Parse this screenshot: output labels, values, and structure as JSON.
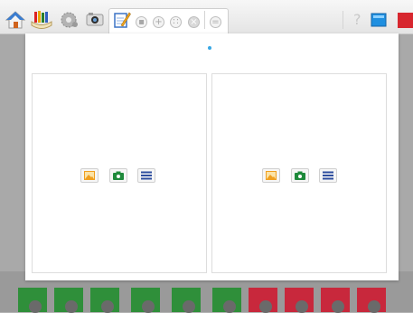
{
  "toolbar": {
    "icons": [
      "home-icon",
      "library-icon",
      "settings-icon",
      "camera-icon",
      "notes-icon",
      "lock-icon",
      "add-icon",
      "grid-icon",
      "close-icon",
      "menu-icon",
      "help-icon",
      "sidebar-icon",
      "stop-icon"
    ],
    "help_label": "?"
  },
  "panes": [
    {
      "buttons": [
        "image-icon",
        "camera-icon",
        "list-icon"
      ]
    },
    {
      "buttons": [
        "image-icon",
        "camera-icon",
        "list-icon"
      ]
    }
  ],
  "colors": {
    "accent_blue": "#38a7e4",
    "image_btn": "#f0a020",
    "camera_btn": "#1f8a3b",
    "list_btn": "#2f4f9f",
    "tile_green": "#2f8f3a",
    "tile_red": "#c8283c"
  }
}
